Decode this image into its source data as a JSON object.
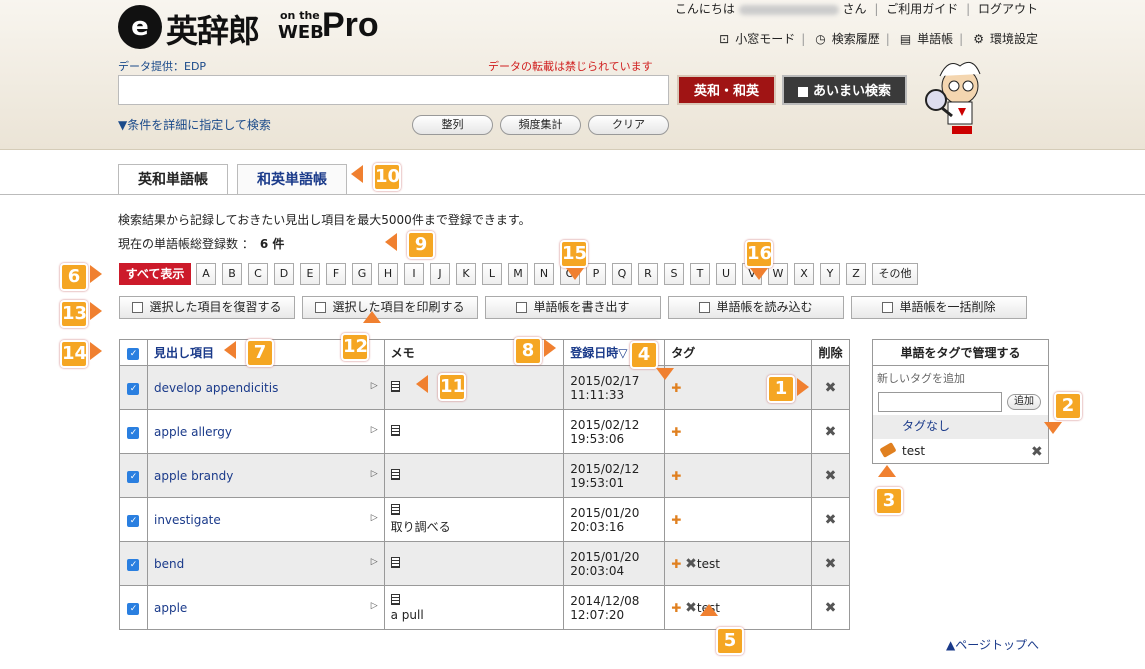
{
  "header": {
    "logo_mark": "e",
    "logo_title": "英辞郎",
    "logo_onthe": "on the",
    "logo_web": "WEB",
    "logo_pro": "Pro",
    "greeting_prefix": "こんにちは",
    "greeting_suffix": "さん",
    "guide_link": "ご利用ガイド",
    "logout_link": "ログアウト",
    "tools": [
      "小窓モード",
      "検索履歴",
      "単語帳",
      "環境設定"
    ],
    "data_provider": "データ提供：EDP",
    "copy_notice": "データの転載は禁じられています",
    "search_value": "",
    "btn_eiwa": "英和・和英",
    "btn_aimai": "あいまい検索",
    "advanced_search": "▼条件を詳細に指定して検索",
    "btn_seiretsu": "整列",
    "btn_hindo": "頻度集計",
    "btn_clear": "クリア"
  },
  "tabs": {
    "eiwa": "英和単語帳",
    "waei": "和英単語帳"
  },
  "info": {
    "line1": "検索結果から記録しておきたい見出し項目を最大5000件まで登録できます。",
    "line2_label": "現在の単語帳総登録数 ：",
    "line2_count": "6 件"
  },
  "letters": {
    "show_all": "すべて表示",
    "items": [
      "A",
      "B",
      "C",
      "D",
      "E",
      "F",
      "G",
      "H",
      "I",
      "J",
      "K",
      "L",
      "M",
      "N",
      "O",
      "P",
      "Q",
      "R",
      "S",
      "T",
      "U",
      "V",
      "W",
      "X",
      "Y",
      "Z"
    ],
    "other": "その他"
  },
  "actions": {
    "review": "選択した項目を復習する",
    "print": "選択した項目を印刷する",
    "export": "単語帳を書き出す",
    "import": "単語帳を読み込む",
    "delete_all": "単語帳を一括削除"
  },
  "table": {
    "headers": {
      "heading": "見出し項目",
      "memo": "メモ",
      "date": "登録日時▽",
      "tag": "タグ",
      "delete": "削除"
    },
    "rows": [
      {
        "word": "develop appendicitis",
        "memo": "",
        "date": "2015/02/17",
        "time": "11:11:33",
        "tag": ""
      },
      {
        "word": "apple allergy",
        "memo": "",
        "date": "2015/02/12",
        "time": "19:53:06",
        "tag": ""
      },
      {
        "word": "apple brandy",
        "memo": "",
        "date": "2015/02/12",
        "time": "19:53:01",
        "tag": ""
      },
      {
        "word": "investigate",
        "memo": "取り調べる",
        "date": "2015/01/20",
        "time": "20:03:16",
        "tag": ""
      },
      {
        "word": "bend",
        "memo": "",
        "date": "2015/01/20",
        "time": "20:03:04",
        "tag": "test"
      },
      {
        "word": "apple",
        "memo": "a pull",
        "date": "2014/12/08",
        "time": "12:07:20",
        "tag": "test"
      }
    ]
  },
  "tag_panel": {
    "title": "単語をタグで管理する",
    "add_label": "新しいタグを追加",
    "add_button": "追加",
    "no_tag": "タグなし",
    "tags": [
      "test"
    ]
  },
  "page_top": "▲ページトップへ",
  "callouts": [
    "1",
    "2",
    "3",
    "4",
    "5",
    "6",
    "7",
    "8",
    "9",
    "10",
    "11",
    "12",
    "13",
    "14",
    "15",
    "16"
  ],
  "colors": {
    "accent": "#f5a623",
    "brand_red": "#cc1a2a",
    "link": "#1a3a8a"
  }
}
